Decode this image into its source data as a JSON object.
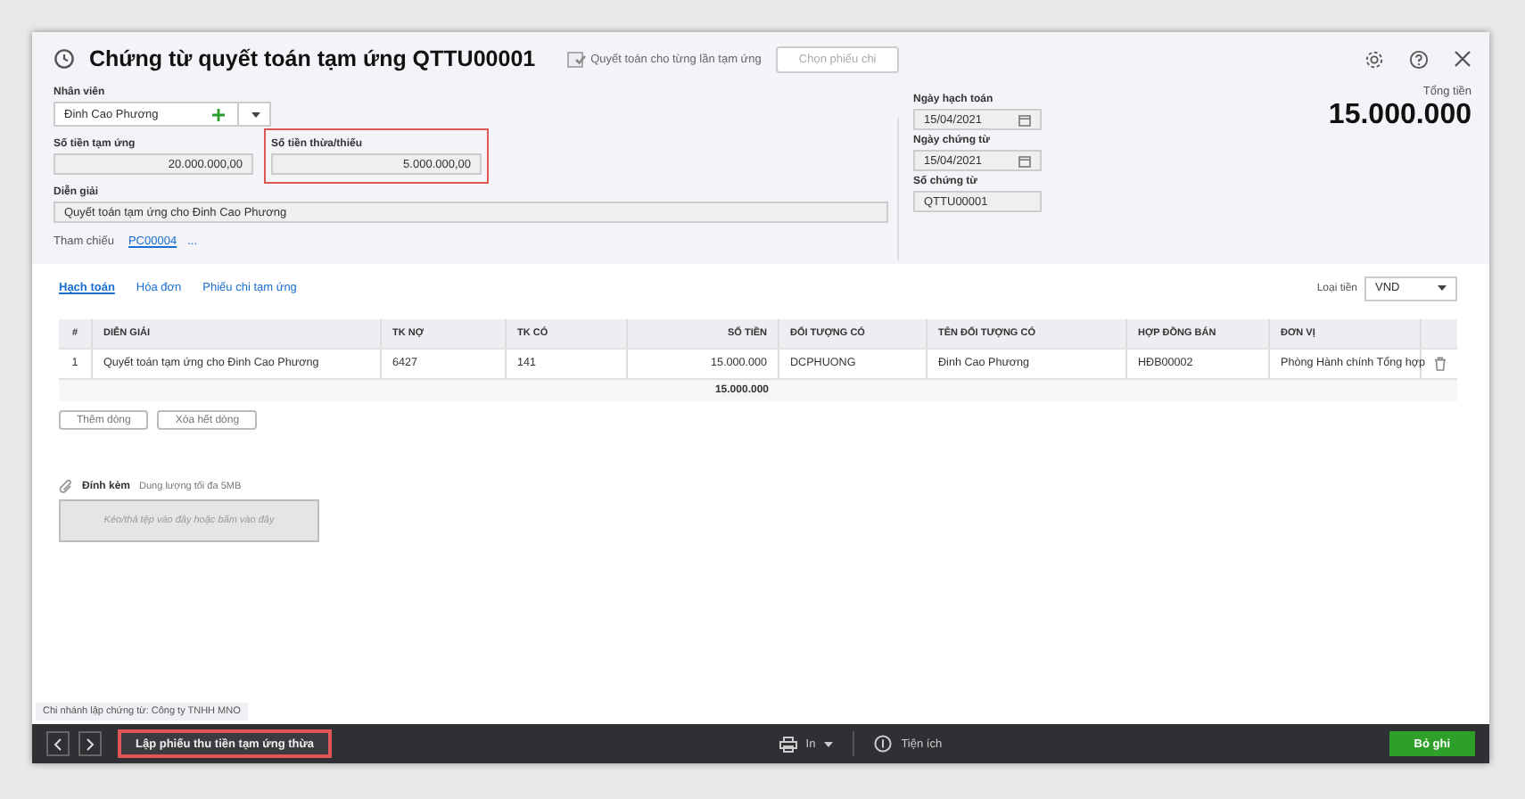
{
  "window": {
    "title": "Chứng từ quyết toán tạm ứng QTTU00001"
  },
  "settle_each": {
    "label": "Quyết toán cho từng lần tạm ứng",
    "checked": true,
    "disabled": true
  },
  "choose_voucher_button": {
    "label": "Chọn phiếu chi",
    "disabled": true
  },
  "employee": {
    "label": "Nhân viên",
    "value": "Đinh  Cao Phương"
  },
  "advance_amount": {
    "label": "Số tiền tạm ứng",
    "value": "20.000.000,00"
  },
  "difference_amount": {
    "label": "Số tiền thừa/thiếu",
    "value": "5.000.000,00",
    "highlighted": true
  },
  "description": {
    "label": "Diễn giải",
    "value": "Quyết toán tạm ứng cho Đinh  Cao Phương"
  },
  "reference": {
    "label": "Tham chiếu",
    "link": "PC00004",
    "more": "..."
  },
  "posting_date": {
    "label": "Ngày hạch toán",
    "value": "15/04/2021"
  },
  "voucher_date": {
    "label": "Ngày chứng từ",
    "value": "15/04/2021"
  },
  "voucher_number": {
    "label": "Số chứng từ",
    "value": "QTTU00001"
  },
  "total": {
    "label": "Tổng tiền",
    "value": "15.000.000"
  },
  "tabs": [
    {
      "label": "Hạch toán",
      "selected": true
    },
    {
      "label": "Hóa đơn",
      "selected": false
    },
    {
      "label": "Phiếu chi tạm ứng",
      "selected": false
    }
  ],
  "currency": {
    "label": "Loại tiền",
    "value": "VND"
  },
  "table": {
    "columns": [
      "#",
      "DIỄN GIẢI",
      "TK NỢ",
      "TK CÓ",
      "SỐ TIỀN",
      "ĐỐI TƯỢNG CÓ",
      "TÊN ĐỐI TƯỢNG CÓ",
      "HỢP ĐỒNG BÁN",
      "ĐƠN VỊ"
    ],
    "rows": [
      [
        "1",
        "Quyết toán tạm ứng cho Đinh  Cao Phương",
        "6427",
        "141",
        "15.000.000",
        "DCPHUONG",
        "Đinh  Cao Phương",
        "HĐB00002",
        "Phòng Hành chính Tổng hợp"
      ]
    ],
    "total": "15.000.000"
  },
  "row_buttons": [
    "Thêm dòng",
    "Xóa hết dòng"
  ],
  "attachment": {
    "label": "Đính kèm",
    "hint": "Dung lượng tối đa 5MB",
    "dropzone": "Kéo/thả tệp vào đây hoặc bấm vào đây"
  },
  "branch_note": "Chi nhánh lập chứng từ: Công ty TNHH MNO",
  "footer": {
    "action_button": {
      "label": "Lập phiếu thu tiền tạm ứng thừa",
      "highlighted": true
    },
    "print": "In",
    "utilities": "Tiện ích",
    "save": "Bỏ ghi"
  }
}
